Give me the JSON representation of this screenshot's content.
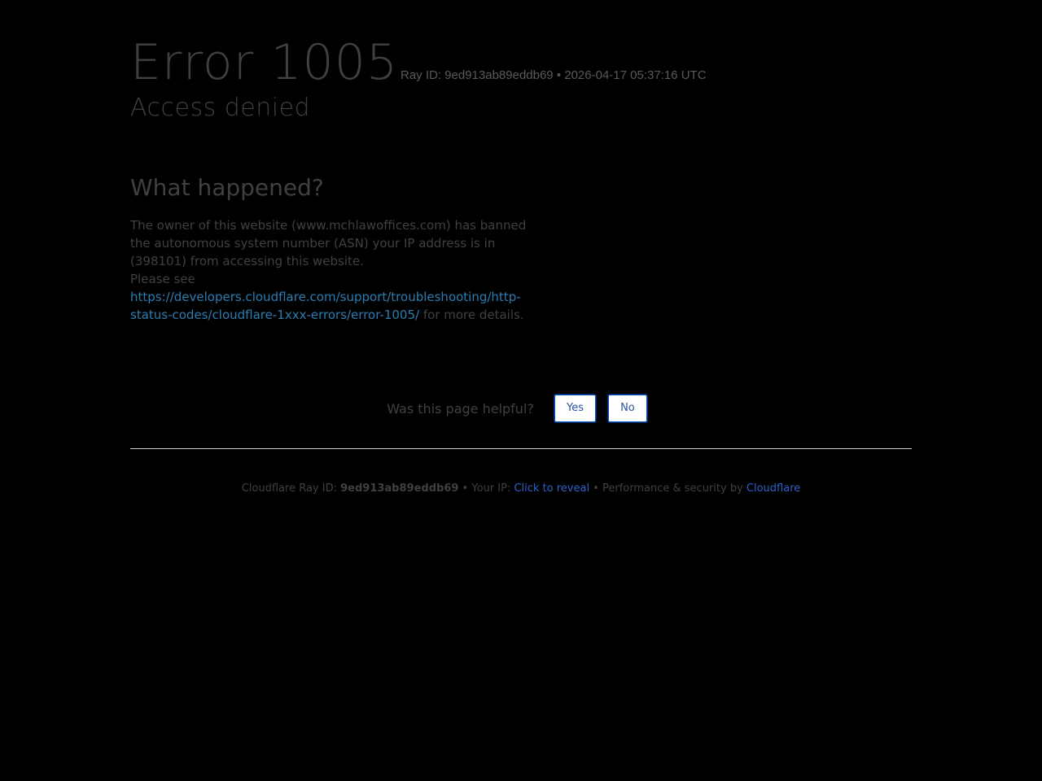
{
  "header": {
    "error_title": "Error 1005",
    "ray_inline": "Ray ID: 9ed913ab89eddb69 • 2026-04-17 05:37:16 UTC",
    "subtitle": "Access denied"
  },
  "main": {
    "section_title": "What happened?",
    "paragraph": "The owner of this website (www.mchlawoffices.com) has banned the autonomous system number (ASN) your IP address is in (398101) from accessing this website.",
    "see_prefix": "Please see",
    "link_text": "https://developers.cloudflare.com/support/troubleshooting/http-status-codes/cloudflare-1xxx-errors/error-1005/",
    "see_suffix": " for more details."
  },
  "feedback": {
    "question": "Was this page helpful?",
    "yes_label": "Yes",
    "no_label": "No"
  },
  "footer": {
    "ray_prefix": "Cloudflare Ray ID: ",
    "ray_id": "9ed913ab89eddb69",
    "sep1": " • ",
    "ip_prefix": "Your IP: ",
    "reveal_label": "Click to reveal",
    "sep2": " • ",
    "perf_prefix": "Performance & security by ",
    "cloudflare_label": "Cloudflare"
  },
  "colors": {
    "background": "#000000",
    "text": "#404040",
    "link": "#2c7cb0",
    "button_border": "#0051c3"
  }
}
